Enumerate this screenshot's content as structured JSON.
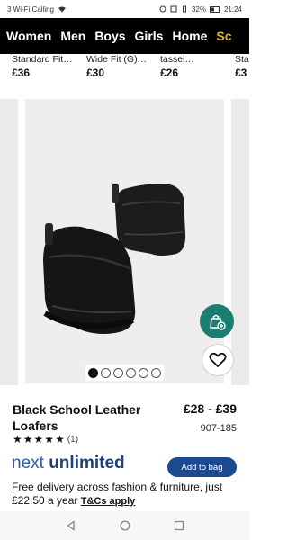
{
  "status_bar": {
    "carrier": "3 Wi-Fi Calling",
    "battery": "32%",
    "time": "21:24"
  },
  "nav": {
    "items": [
      "Women",
      "Men",
      "Boys",
      "Girls",
      "Home",
      "Sc"
    ]
  },
  "carousel": {
    "items": [
      {
        "title": "Standard Fit…",
        "price": "£36"
      },
      {
        "title": "Wide Fit (G)…",
        "price": "£30"
      },
      {
        "title": "tassel…",
        "price": "£26"
      },
      {
        "title": "Sta",
        "price": "£3"
      }
    ]
  },
  "gallery": {
    "dots_total": 6,
    "active_index": 0
  },
  "product": {
    "title": "Black School Leather Loafers",
    "price": "£28 - £39",
    "code": "907-185",
    "rating": 5,
    "rating_count": "(1)"
  },
  "unlimited": {
    "brand_part1": "next ",
    "brand_part2": "unlimited",
    "add_button": "Add to bag",
    "description": "Free delivery across fashion & furniture, just £22.50 a year ",
    "tc_link": "T&Cs apply"
  },
  "colors": {
    "nav_bg": "#000000",
    "accent_teal": "#1a7f72",
    "brand_blue": "#1c4a8f"
  }
}
